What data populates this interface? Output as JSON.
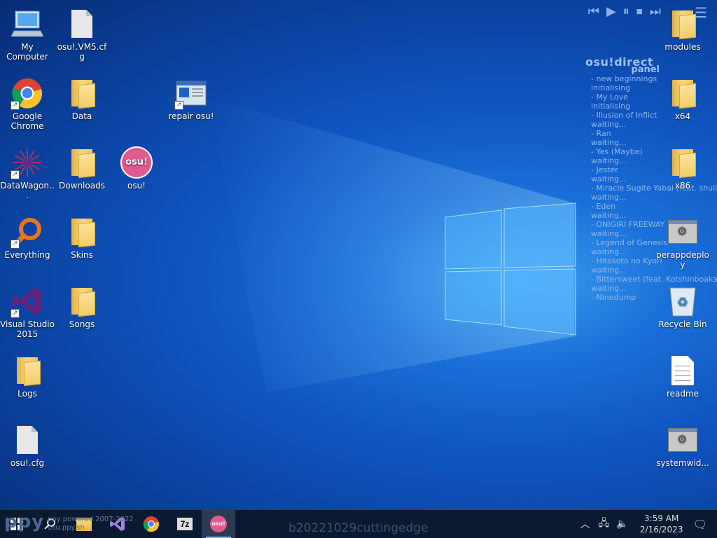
{
  "desktop": {
    "icons_left": [
      {
        "label": "My Computer",
        "type": "computer"
      },
      {
        "label": "Google Chrome",
        "type": "chrome",
        "shortcut": true
      },
      {
        "label": "DataWagon...",
        "type": "datawagon",
        "shortcut": true
      },
      {
        "label": "Everything",
        "type": "everything",
        "shortcut": true
      },
      {
        "label": "Visual Studio 2015",
        "type": "vs",
        "shortcut": true
      },
      {
        "label": "Logs",
        "type": "folder"
      },
      {
        "label": "osu!.cfg",
        "type": "file"
      }
    ],
    "icons_col2": [
      {
        "label": "osu!.VM5.cfg",
        "type": "file"
      },
      {
        "label": "Data",
        "type": "folder"
      },
      {
        "label": "Downloads",
        "type": "folder"
      },
      {
        "label": "Skins",
        "type": "folder"
      },
      {
        "label": "Songs",
        "type": "folder"
      }
    ],
    "icons_col3": [
      {
        "label": "repair osu!",
        "type": "window",
        "shortcut": true
      },
      {
        "label": "osu!",
        "type": "osu"
      }
    ],
    "icons_right": [
      {
        "label": "modules",
        "type": "folder"
      },
      {
        "label": "x64",
        "type": "folder"
      },
      {
        "label": "x86",
        "type": "folder"
      },
      {
        "label": "perappdeploy",
        "type": "cfgwin"
      },
      {
        "label": "Recycle Bin",
        "type": "recycle"
      },
      {
        "label": "readme",
        "type": "doc"
      },
      {
        "label": "systemwid...",
        "type": "cfgwin"
      }
    ]
  },
  "osu_panel": {
    "title": "osu!direct",
    "subtitle": "panel",
    "entries": [
      {
        "name": "- new beginnings",
        "status": "initialising"
      },
      {
        "name": "- My Love",
        "status": "initialising"
      },
      {
        "name": "- Illusion of Inflict",
        "status": "waiting..."
      },
      {
        "name": "- Ran",
        "status": "waiting..."
      },
      {
        "name": "- Yes (Maybe)",
        "status": "waiting..."
      },
      {
        "name": "- Jester",
        "status": "waiting..."
      },
      {
        "name": "- Miracle Sugite Yabai (feat. shull",
        "status": "waiting..."
      },
      {
        "name": "- Eden",
        "status": "waiting..."
      },
      {
        "name": "- ONIGIRI FREEWAY",
        "status": "waiting..."
      },
      {
        "name": "- Legend of Genesis",
        "status": "waiting..."
      },
      {
        "name": "- Hitokoto no Kyori",
        "status": "waiting..."
      },
      {
        "name": "- Bittersweet (feat. Kotshinboaka",
        "status": "waiting..."
      },
      {
        "name": "- Ninedump",
        "status": ""
      }
    ]
  },
  "media_icons": [
    "skip-previous-icon",
    "play-icon",
    "pause-icon",
    "stop-icon",
    "skip-next-icon"
  ],
  "taskbar": {
    "watermark": "ppy",
    "powered_text": "ppy powered 2007-2022",
    "powered_sub": "osu.ppy.sh",
    "build": "b20221029cuttingedge",
    "clock_time": "3:59 AM",
    "clock_date": "2/16/2023",
    "apps": [
      "start",
      "search",
      "file-explorer",
      "visual-studio",
      "chrome",
      "7zip",
      "osu"
    ]
  }
}
